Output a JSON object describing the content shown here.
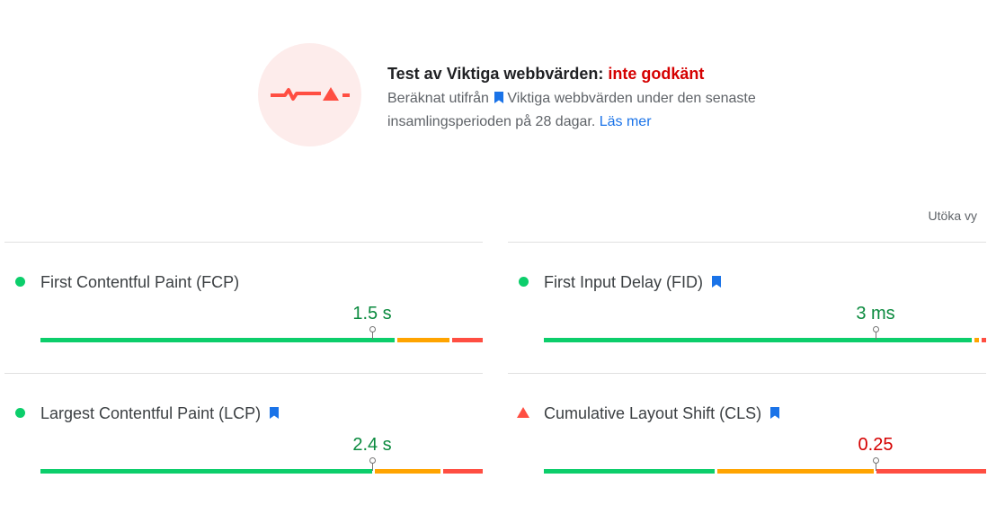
{
  "summary": {
    "title_prefix": "Test av Viktiga webbvärden: ",
    "title_status": "inte godkänt",
    "desc_before": "Beräknat utifrån",
    "desc_after": "Viktiga webbvärden under den senaste insamlingsperioden på 28 dagar.",
    "learn_more": "Läs mer",
    "icon": "cwv-failed-icon",
    "status_color": "#d50000"
  },
  "expand_label": "Utöka vy",
  "colors": {
    "good": "#0cce6b",
    "needs_improvement": "#ffa400",
    "poor": "#ff4e42",
    "bookmark": "#1a73e8"
  },
  "metrics": [
    {
      "name": "First Contentful Paint (FCP)",
      "value": "1.5 s",
      "status": "pass",
      "core_web_vital": false,
      "distribution": {
        "good": 0.81,
        "needs_improvement": 0.12,
        "poor": 0.07
      },
      "marker_position": 0.75
    },
    {
      "name": "First Input Delay (FID)",
      "value": "3 ms",
      "status": "pass",
      "core_web_vital": true,
      "distribution": {
        "good": 0.98,
        "needs_improvement": 0.01,
        "poor": 0.01
      },
      "marker_position": 0.75
    },
    {
      "name": "Largest Contentful Paint (LCP)",
      "value": "2.4 s",
      "status": "pass",
      "core_web_vital": true,
      "distribution": {
        "good": 0.76,
        "needs_improvement": 0.15,
        "poor": 0.09
      },
      "marker_position": 0.75
    },
    {
      "name": "Cumulative Layout Shift (CLS)",
      "value": "0.25",
      "status": "fail",
      "core_web_vital": true,
      "distribution": {
        "good": 0.39,
        "needs_improvement": 0.36,
        "poor": 0.25
      },
      "marker_position": 0.75
    }
  ]
}
